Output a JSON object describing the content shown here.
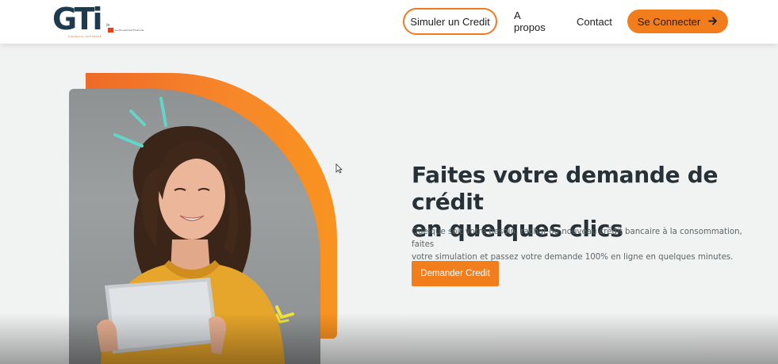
{
  "header": {
    "logo_text": "GTi",
    "logo_tagline": "FINANCIAL SOFTWARE",
    "logo_partner": "Le Mouvement Financier",
    "nav": {
      "simuler": "Simuler un Credit",
      "apropos": "A propos",
      "contact": "Contact",
      "connect": "Se Connecter",
      "connect_icon": "arrow-right-icon"
    }
  },
  "hero": {
    "title_line1": "Faites votre demande de crédit",
    "title_line2": "en quelques clics",
    "description_line1": "Quelque soit votre besoin, rachat ou nouveau crédit bancaire à la consommation, faites",
    "description_line2": "votre simulation et passez votre demande 100% en ligne en quelques minutes.",
    "button": "Demander Credit"
  },
  "colors": {
    "accent": "#f27d1d",
    "brand_dark": "#1e3a4f",
    "title": "#263238",
    "background": "#f1f2f2"
  }
}
